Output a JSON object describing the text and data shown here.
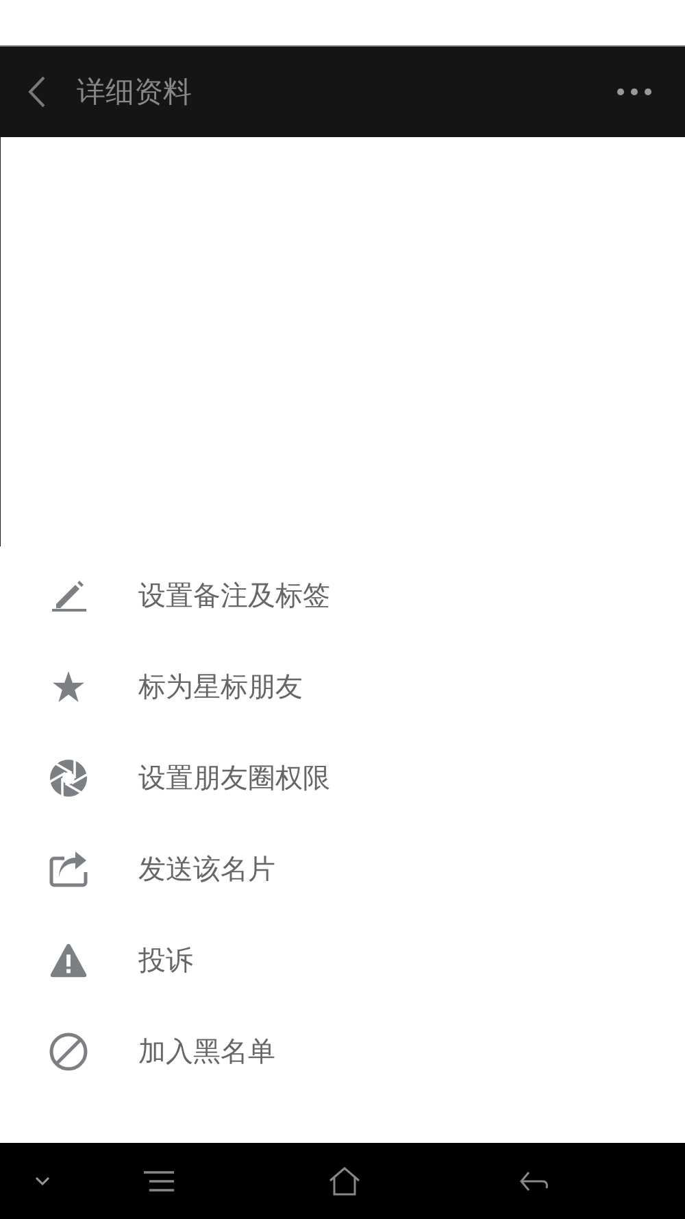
{
  "header": {
    "title": "详细资料"
  },
  "menu": [
    {
      "label": "设置备注及标签"
    },
    {
      "label": "标为星标朋友"
    },
    {
      "label": "设置朋友圈权限"
    },
    {
      "label": "发送该名片"
    },
    {
      "label": "投诉"
    },
    {
      "label": "加入黑名单"
    }
  ]
}
